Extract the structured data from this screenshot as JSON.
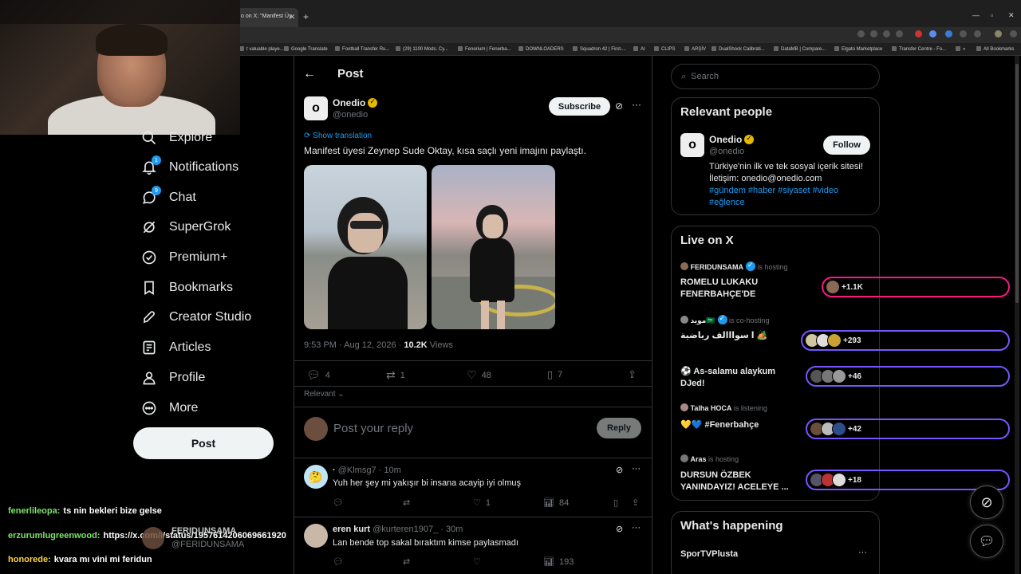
{
  "browser": {
    "tab_title": "o on X: \"Manifest Üy",
    "tab_close": "✕",
    "new_tab": "+",
    "bookmarks": [
      "t valuable playe...",
      "Google Translate",
      "Football Transfer Ru...",
      "(29) 1100 Mods. Cy...",
      "Fenerium | Fenerba...",
      "DOWNLOADERS",
      "Squadron 42 | First-...",
      "AI",
      "CLIPS",
      "ARŞİV",
      "DualShock Calibrati...",
      "DataMB | Compare...",
      "Elgato Marketplace",
      "Transfer Centre - Fo..."
    ],
    "all_bookmarks": "All Bookmarks"
  },
  "nav": {
    "items": [
      {
        "label": "Explore",
        "icon": "search-icon"
      },
      {
        "label": "Notifications",
        "icon": "bell-icon",
        "badge": "1"
      },
      {
        "label": "Chat",
        "icon": "chat-icon",
        "badge": "9"
      },
      {
        "label": "SuperGrok",
        "icon": "grok-icon"
      },
      {
        "label": "Premium+",
        "icon": "premium-icon"
      },
      {
        "label": "Bookmarks",
        "icon": "bookmark-icon"
      },
      {
        "label": "Creator Studio",
        "icon": "rocket-icon"
      },
      {
        "label": "Articles",
        "icon": "article-icon"
      },
      {
        "label": "Profile",
        "icon": "person-icon"
      },
      {
        "label": "More",
        "icon": "more-icon"
      }
    ],
    "post_label": "Post"
  },
  "main": {
    "header_title": "Post",
    "tweet": {
      "name": "Onedio",
      "handle": "@onedio",
      "subscribe_label": "Subscribe",
      "show_translation": "Show translation",
      "text": "Manifest üyesi Zeynep Sude Oktay, kısa saçlı yeni imajını paylaştı.",
      "timestamp": "9:53 PM · Aug 12, 2026 · ",
      "views_count": "10.2K",
      "views_label": " Views",
      "replies": "4",
      "reposts": "1",
      "likes": "48",
      "bookmarks": "7"
    },
    "sort_label": "Relevant",
    "reply_placeholder": "Post your reply",
    "reply_button": "Reply",
    "replies": [
      {
        "name": "·",
        "handle": "@Klmsg7 · 10m",
        "text": "Yuh her şey mi yakışır bi insana acayip iyi olmuş",
        "likes": "1",
        "views": "84"
      },
      {
        "name": "eren kurt",
        "handle": "@kurteren1907_ · 30m",
        "text": "Lan bende top sakal bıraktım kimse paylasmadı",
        "likes": "",
        "views": "193"
      }
    ]
  },
  "right": {
    "search_placeholder": "Search",
    "relevant_title": "Relevant people",
    "person": {
      "name": "Onedio",
      "handle": "@onedio",
      "follow_label": "Follow",
      "bio": "Türkiye'nin ilk ve tek sosyal içerik sitesi! İletişim: onedio@onedio.com",
      "tags": "#gündem #haber #siyaset #video #eğlence"
    },
    "live_title": "Live on X",
    "spaces": [
      {
        "host": "FERIDUNSAMA",
        "status": "is hosting",
        "title": "ROMELU LUKAKU FENERBAHÇE'DE",
        "count": "+1.1K"
      },
      {
        "host": "مويد🇸🇦",
        "status": "is co-hosting",
        "title": "ا سوااالف رياضية 🏕️",
        "count": "+293"
      },
      {
        "host": "",
        "status": "",
        "title": "⚽ As-salamu alaykum DJed!",
        "count": "+46"
      },
      {
        "host": "Talha HOCA",
        "status": "is listening",
        "title": "💛💙 #Fenerbahçe",
        "count": "+42"
      },
      {
        "host": "Aras",
        "status": "is hosting",
        "title": "DURSUN ÖZBEK YANINDAYIZ! ACELEYE ...",
        "count": "+18"
      }
    ],
    "happening_title": "What's happening",
    "trend_name": "SporTVPlusta"
  },
  "chat_overlay": [
    {
      "user": "fenerlileopa:",
      "msg": "ts nin bekleri bize gelse",
      "color": "#7ee36b"
    },
    {
      "user": "erzurumlugreenwood:",
      "msg": "https://x.com/i/status/1957614206069661920",
      "color": "#7ee36b"
    },
    {
      "user": "honorede:",
      "msg": "kvara mı vini mi feridun",
      "color": "#ffd23f"
    }
  ],
  "profile_tip": {
    "name": "FERIDUNSAMA",
    "handle": "@FERIDUNSAMA"
  }
}
